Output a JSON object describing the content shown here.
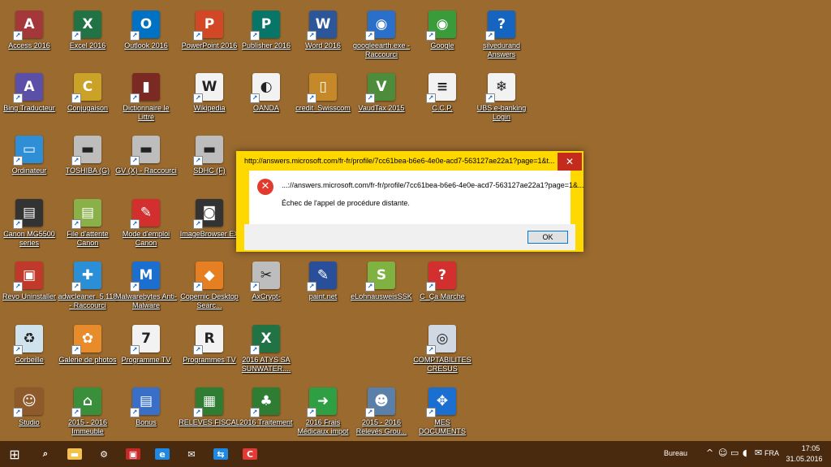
{
  "desktop": {
    "icons": [
      {
        "label": "Access 2016",
        "icon": "access-icon",
        "glyph": "A",
        "color": "#a4373a"
      },
      {
        "label": "Excel 2016",
        "icon": "excel-icon",
        "glyph": "X",
        "color": "#217346"
      },
      {
        "label": "Outlook 2016",
        "icon": "outlook-icon",
        "glyph": "O",
        "color": "#0072c6"
      },
      {
        "label": "PowerPoint 2016",
        "icon": "powerpoint-icon",
        "glyph": "P",
        "color": "#d24726"
      },
      {
        "label": "Publisher 2016",
        "icon": "publisher-icon",
        "glyph": "P",
        "color": "#077568"
      },
      {
        "label": "Word 2016",
        "icon": "word-icon",
        "glyph": "W",
        "color": "#2b579a"
      },
      {
        "label": "googleearth.exe - Raccourci",
        "icon": "google-earth-icon",
        "glyph": "◉",
        "color": "#2a6fc9"
      },
      {
        "label": "Google",
        "icon": "google-icon",
        "glyph": "◉",
        "color": "#3a9b3a"
      },
      {
        "label": "silvedurand Answers",
        "icon": "help-icon",
        "glyph": "?",
        "color": "#1565c0"
      },
      {
        "label": "Bing Traducteur",
        "icon": "bing-translator-icon",
        "glyph": "A",
        "color": "#5b4fa8"
      },
      {
        "label": "Conjugaison",
        "icon": "conjugaison-icon",
        "glyph": "C",
        "color": "#c9a227"
      },
      {
        "label": "Dictionnaire le Littré",
        "icon": "book-icon",
        "glyph": "▮",
        "color": "#7a2a22"
      },
      {
        "label": "Wikipedia",
        "icon": "wikipedia-icon",
        "glyph": "W",
        "color": "#f2f2f2"
      },
      {
        "label": "OANDA",
        "icon": "oanda-icon",
        "glyph": "◐",
        "color": "#f2f2f2"
      },
      {
        "label": "credit_Swisscom",
        "icon": "phone-icon",
        "glyph": "▯",
        "color": "#c6892a"
      },
      {
        "label": "VaudTax 2015",
        "icon": "vaudtax-icon",
        "glyph": "V",
        "color": "#4c8c3a"
      },
      {
        "label": "C.C.P.",
        "icon": "postfinance-icon",
        "glyph": "≡",
        "color": "#f2f2f2"
      },
      {
        "label": "UBS e-banking Login",
        "icon": "ubs-icon",
        "glyph": "❄",
        "color": "#f2f2f2"
      },
      {
        "label": "Ordinateur",
        "icon": "computer-icon",
        "glyph": "▭",
        "color": "#2f8fd6"
      },
      {
        "label": "TOSHIBA (G)",
        "icon": "drive-icon",
        "glyph": "▬",
        "color": "#bdbdbd"
      },
      {
        "label": "GV (X) - Raccourci",
        "icon": "drive-icon",
        "glyph": "▬",
        "color": "#bdbdbd"
      },
      {
        "label": "SDHC (F)",
        "icon": "sdhc-icon",
        "glyph": "▬",
        "color": "#bdbdbd"
      },
      {
        "label": "Canon MG5500 series",
        "icon": "printer-icon",
        "glyph": "▤",
        "color": "#333333"
      },
      {
        "label": "File d'attente Canon",
        "icon": "print-queue-icon",
        "glyph": "▤",
        "color": "#8ab04a"
      },
      {
        "label": "Mode d'emploi Canon",
        "icon": "pdf-icon",
        "glyph": "✎",
        "color": "#d32f2f"
      },
      {
        "label": "ImageBrowser EX",
        "icon": "camera-icon",
        "glyph": "◙",
        "color": "#333333"
      },
      {
        "label": "Revo Uninstaller",
        "icon": "revo-icon",
        "glyph": "▣",
        "color": "#c0392b"
      },
      {
        "label": "adwcleaner_5.118 - Raccourci",
        "icon": "adwcleaner-icon",
        "glyph": "✚",
        "color": "#2a8fd6"
      },
      {
        "label": "Malwarebytes Anti-Malware",
        "icon": "malwarebytes-icon",
        "glyph": "M",
        "color": "#1a6fd1"
      },
      {
        "label": "Copernic Desktop Searc...",
        "icon": "copernic-icon",
        "glyph": "◆",
        "color": "#e67e22"
      },
      {
        "label": "AxCrypt-",
        "icon": "axcrypt-icon",
        "glyph": "✂",
        "color": "#bdbdbd"
      },
      {
        "label": "paint.net",
        "icon": "paintnet-icon",
        "glyph": "✎",
        "color": "#2a4f9a"
      },
      {
        "label": "eLohnausweisSSK",
        "icon": "ssk-icon",
        "glyph": "S",
        "color": "#7fb241"
      },
      {
        "label": "C_Ça Marche",
        "icon": "ccm-icon",
        "glyph": "?",
        "color": "#d32f2f"
      },
      {
        "label": "Corbeille",
        "icon": "recycle-bin-icon",
        "glyph": "♻",
        "color": "#cfe3ef"
      },
      {
        "label": "Galerie de photos",
        "icon": "photo-gallery-icon",
        "glyph": "✿",
        "color": "#e88b2a"
      },
      {
        "label": "Programme TV",
        "icon": "tv-program-icon",
        "glyph": "7",
        "color": "#f2f2f2"
      },
      {
        "label": "Programmes TV",
        "icon": "tv-program-icon",
        "glyph": "R",
        "color": "#f2f2f2"
      },
      {
        "label": "2016 ATYS SA SUNWATER....",
        "icon": "excel-file-icon",
        "glyph": "X",
        "color": "#217346"
      },
      {
        "label": "COMPTABILITES CRESUS",
        "icon": "cresus-icon",
        "glyph": "◎",
        "color": "#cfd8e3"
      },
      {
        "label": "Studio",
        "icon": "studio-icon",
        "glyph": "☺",
        "color": "#8e5a2c"
      },
      {
        "label": "2015 - 2016 Immeuble",
        "icon": "building-icon",
        "glyph": "⌂",
        "color": "#3a8f3a"
      },
      {
        "label": "Bonus",
        "icon": "bonus-icon",
        "glyph": "▤",
        "color": "#3a6fc9"
      },
      {
        "label": "RELEVES FISCAL",
        "icon": "chart-monitor-icon",
        "glyph": "▦",
        "color": "#2e7d32"
      },
      {
        "label": "2016 Traitement",
        "icon": "tree-icon",
        "glyph": "♣",
        "color": "#2e7d32"
      },
      {
        "label": "2016 Frais Médicaux impot",
        "icon": "arrow-icon",
        "glyph": "➜",
        "color": "#2ea043"
      },
      {
        "label": "2015 - 2016 Relevés Grou...",
        "icon": "people-icon",
        "glyph": "☻",
        "color": "#5a7fa8"
      },
      {
        "label": "MES DOCUMENTS",
        "icon": "documents-icon",
        "glyph": "✥",
        "color": "#1a6fd1"
      }
    ]
  },
  "dialog": {
    "title": "http://answers.microsoft.com/fr-fr/profile/7cc61bea-b6e6-4e0e-acd7-563127ae22a1?page=1&t...",
    "close": "✕",
    "url": "...://answers.microsoft.com/fr-fr/profile/7cc61bea-b6e6-4e0e-acd7-563127ae22a1?page=1&...",
    "message": "Échec de l'appel de procédure distante.",
    "ok_label": "OK",
    "error_glyph": "✕"
  },
  "taskbar": {
    "start_glyph": "⊞",
    "apps": [
      {
        "name": "search-icon",
        "glyph": "⌕",
        "color": "transparent"
      },
      {
        "name": "file-explorer-icon",
        "glyph": "▬",
        "color": "#f2c14e"
      },
      {
        "name": "settings-icon",
        "glyph": "⚙",
        "color": "transparent"
      },
      {
        "name": "store-icon",
        "glyph": "▣",
        "color": "#c62828"
      },
      {
        "name": "edge-icon",
        "glyph": "e",
        "color": "#1e88e5"
      },
      {
        "name": "mail-icon",
        "glyph": "✉",
        "color": "transparent"
      },
      {
        "name": "teamviewer-icon",
        "glyph": "⇆",
        "color": "#1e88e5"
      },
      {
        "name": "ccleaner-icon",
        "glyph": "C",
        "color": "#e53935"
      }
    ],
    "bureau_label": "Bureau",
    "tray_icons": [
      "^",
      "☺",
      "▭",
      "◖",
      "✉"
    ],
    "language": "FRA",
    "time": "17:05",
    "date": "31.05.2016"
  }
}
